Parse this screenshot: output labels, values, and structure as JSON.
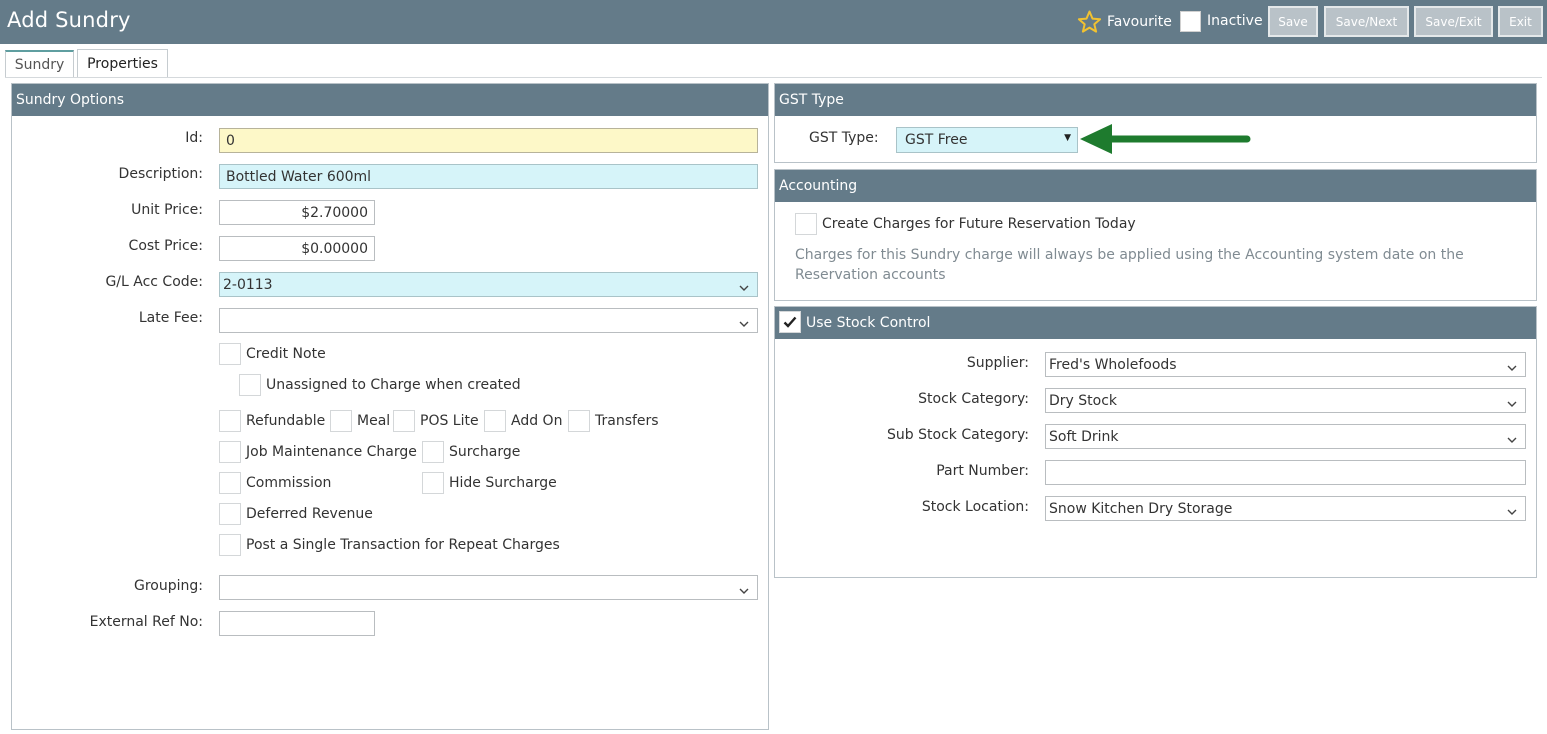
{
  "header": {
    "title": "Add Sundry",
    "favourite_label": "Favourite",
    "inactive_label": "Inactive",
    "buttons": {
      "save": "Save",
      "save_next": "Save/Next",
      "save_exit": "Save/Exit",
      "exit": "Exit"
    }
  },
  "tabs": {
    "sundry": "Sundry",
    "properties": "Properties"
  },
  "sundry_options": {
    "heading": "Sundry Options",
    "id": {
      "label": "Id:",
      "value": "0"
    },
    "description": {
      "label": "Description:",
      "value": "Bottled Water 600ml"
    },
    "unit_price": {
      "label": "Unit Price:",
      "value": "$2.70000"
    },
    "cost_price": {
      "label": "Cost Price:",
      "value": "$0.00000"
    },
    "gl_acc_code": {
      "label": "G/L Acc Code:",
      "value": "2-0113"
    },
    "late_fee": {
      "label": "Late Fee:",
      "value": ""
    },
    "checkboxes": {
      "credit_note": "Credit Note",
      "unassigned": "Unassigned to Charge when created",
      "refundable": "Refundable",
      "meal": "Meal",
      "pos_lite": "POS Lite",
      "add_on": "Add On",
      "transfers": "Transfers",
      "job_maintenance": "Job Maintenance Charge",
      "surcharge": "Surcharge",
      "commission": "Commission",
      "hide_surcharge": "Hide Surcharge",
      "deferred_revenue": "Deferred Revenue",
      "single_transaction": "Post a Single Transaction for Repeat Charges"
    },
    "grouping": {
      "label": "Grouping:",
      "value": ""
    },
    "external_ref": {
      "label": "External Ref No:",
      "value": ""
    }
  },
  "gst": {
    "heading": "GST Type",
    "label": "GST Type:",
    "value": "GST Free",
    "arrow_color": "#1e7b2e"
  },
  "accounting": {
    "heading": "Accounting",
    "future_charges_label": "Create Charges for Future Reservation Today",
    "note_line1": "Charges for this Sundry charge will always be applied using the Accounting system date on the",
    "note_line2": "Reservation accounts"
  },
  "stock": {
    "heading": "Use Stock Control",
    "checked": true,
    "supplier": {
      "label": "Supplier:",
      "value": "Fred's Wholefoods"
    },
    "stock_category": {
      "label": "Stock Category:",
      "value": "Dry Stock"
    },
    "sub_stock_category": {
      "label": "Sub Stock Category:",
      "value": "Soft Drink"
    },
    "part_number": {
      "label": "Part Number:",
      "value": ""
    },
    "stock_location": {
      "label": "Stock Location:",
      "value": "Snow Kitchen Dry Storage"
    }
  },
  "colors": {
    "header_bg": "#647b89",
    "button_bg": "#b9c2c8",
    "star": "#f2c230",
    "id_field_bg": "#fdf8c8",
    "highlight_field_bg": "#d6f4f9"
  }
}
